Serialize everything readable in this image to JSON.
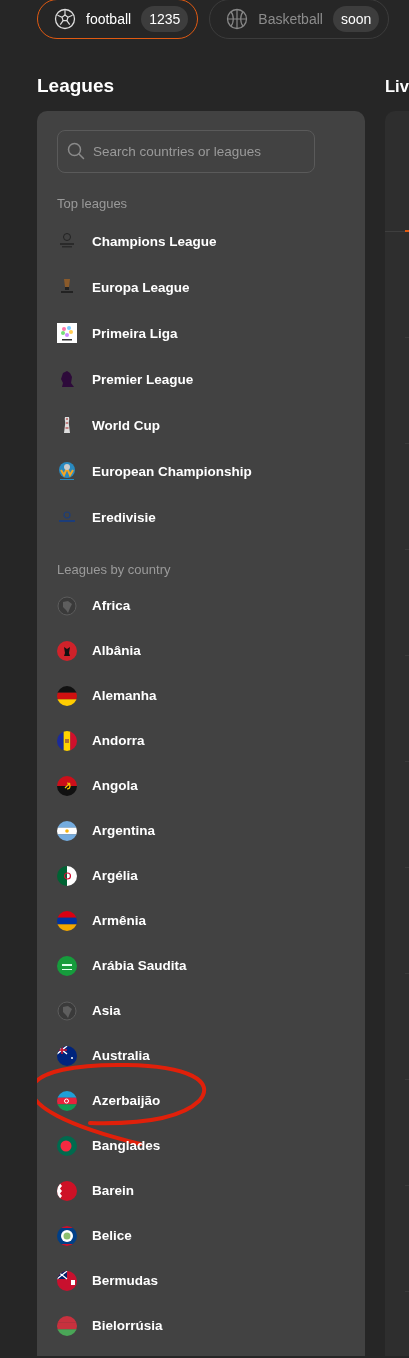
{
  "sport_tabs": [
    {
      "label": "football",
      "badge": "1235",
      "selected": true,
      "kind": "football"
    },
    {
      "label": "Basketball",
      "badge": "soon",
      "selected": false,
      "kind": "basketball"
    }
  ],
  "leagues": {
    "title": "Leagues",
    "search": {
      "placeholder": "Search countries or leagues"
    },
    "top_title": "Top leagues",
    "top_leagues": [
      {
        "label": "Champions League"
      },
      {
        "label": "Europa League"
      },
      {
        "label": "Primeira Liga"
      },
      {
        "label": "Premier League"
      },
      {
        "label": "World Cup"
      },
      {
        "label": "European Championship"
      },
      {
        "label": "Eredivisie"
      }
    ],
    "country_title": "Leagues by country",
    "countries": [
      {
        "label": "Africa",
        "kind": "region",
        "circled": false
      },
      {
        "label": "Albânia",
        "kind": "flag",
        "circled": false
      },
      {
        "label": "Alemanha",
        "kind": "flag",
        "circled": false
      },
      {
        "label": "Andorra",
        "kind": "flag",
        "circled": false
      },
      {
        "label": "Angola",
        "kind": "flag",
        "circled": false
      },
      {
        "label": "Argentina",
        "kind": "flag",
        "circled": false
      },
      {
        "label": "Argélia",
        "kind": "flag",
        "circled": false
      },
      {
        "label": "Armênia",
        "kind": "flag",
        "circled": false
      },
      {
        "label": "Arábia Saudita",
        "kind": "flag",
        "circled": false
      },
      {
        "label": "Asia",
        "kind": "region",
        "circled": false
      },
      {
        "label": "Australia",
        "kind": "flag",
        "circled": false
      },
      {
        "label": "Azerbaijão",
        "kind": "flag",
        "circled": true
      },
      {
        "label": "Banglades",
        "kind": "flag",
        "circled": false
      },
      {
        "label": "Barein",
        "kind": "flag",
        "circled": false
      },
      {
        "label": "Belice",
        "kind": "flag",
        "circled": false
      },
      {
        "label": "Bermudas",
        "kind": "flag",
        "circled": false
      },
      {
        "label": "Bielorrúsia",
        "kind": "flag",
        "circled": false
      }
    ]
  },
  "live": {
    "title": "Liv"
  }
}
